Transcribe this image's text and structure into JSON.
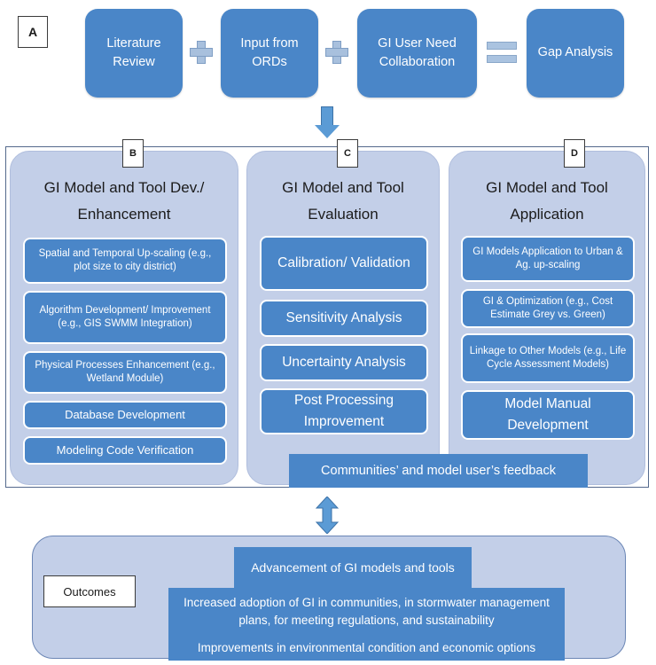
{
  "section_a": {
    "tag": "A",
    "boxes": [
      {
        "label": "Literature Review"
      },
      {
        "label": "Input from ORDs"
      },
      {
        "label": "GI User Need Collaboration"
      },
      {
        "label": "Gap Analysis"
      }
    ],
    "operators": [
      {
        "kind": "plus",
        "symbol": "+"
      },
      {
        "kind": "plus",
        "symbol": "+"
      },
      {
        "kind": "equals",
        "symbol": "="
      }
    ]
  },
  "columns": [
    {
      "tag": "B",
      "title": "GI Model and Tool Dev./ Enhancement",
      "items": [
        "Spatial and Temporal Up-scaling (e.g., plot size to city district)",
        "Algorithm Development/ Improvement  (e.g., GIS SWMM Integration)",
        "Physical Processes Enhancement (e.g., Wetland Module)",
        "Database Development",
        "Modeling Code Verification"
      ]
    },
    {
      "tag": "C",
      "title": "GI Model and Tool Evaluation",
      "items": [
        "Calibration/ Validation",
        "Sensitivity Analysis",
        "Uncertainty Analysis",
        "Post Processing Improvement"
      ]
    },
    {
      "tag": "D",
      "title": "GI Model and Tool Application",
      "items": [
        "GI Models Application to Urban & Ag.  up-scaling",
        "GI & Optimization (e.g., Cost Estimate Grey vs. Green)",
        "Linkage to Other Models (e.g., Life Cycle Assessment Models)",
        "Model Manual Development"
      ]
    }
  ],
  "feedback_bar": "Communities’ and model user’s feedback",
  "outcomes": {
    "tag": "Outcomes",
    "bars": [
      "Advancement of GI models and tools",
      "Increased adoption of GI in communities, in stormwater management plans, for meeting regulations, and sustainability",
      "Improvements in environmental condition and economic options"
    ]
  },
  "colors": {
    "box_blue": "#4a86c8",
    "panel_blue": "#c3cfe8",
    "arrow_blue": "#5b9bd5",
    "operator_blue": "#a8c0dd",
    "text_dark": "#1b1b1b",
    "text_light": "#ffffff"
  }
}
